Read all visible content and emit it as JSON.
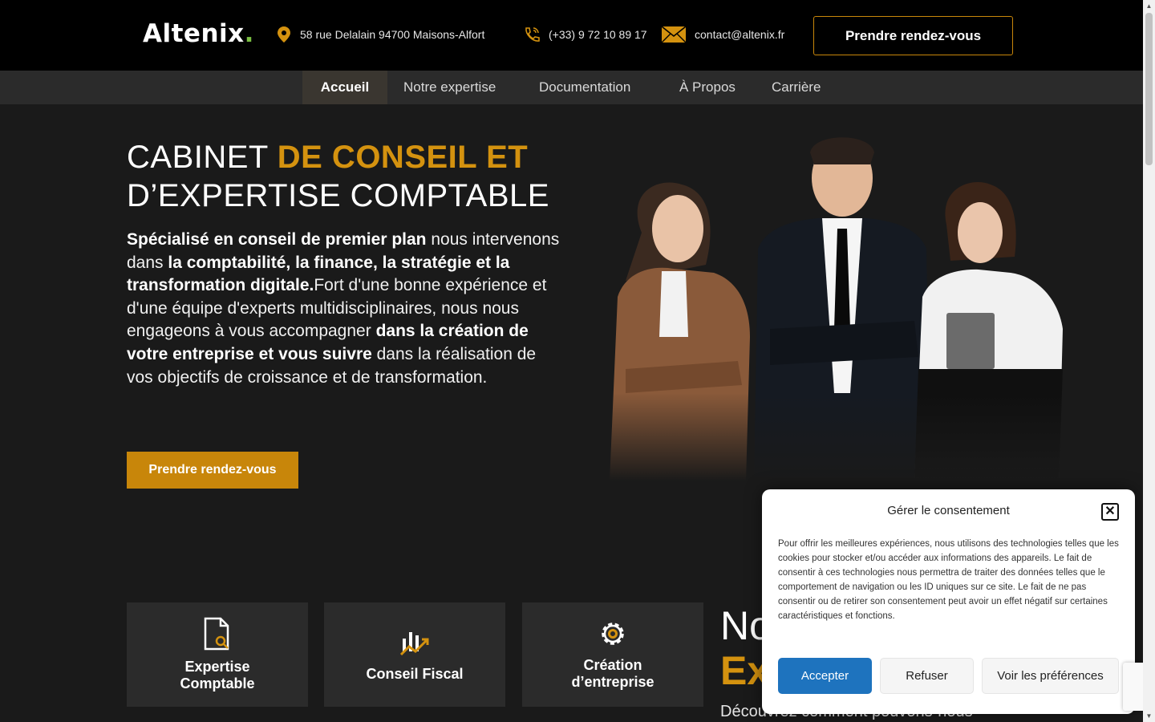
{
  "header": {
    "logo_text": "Altenix",
    "logo_dot": ".",
    "address": "58 rue Delalain 94700 Maisons-Alfort",
    "phone": "(+33) 9 72 10 89 17",
    "email": "contact@altenix.fr",
    "cta_label": "Prendre rendez-vous"
  },
  "nav": {
    "items": [
      {
        "label": "Accueil",
        "active": true
      },
      {
        "label": "Notre expertise"
      },
      {
        "label": "Documentation"
      },
      {
        "label": "À Propos"
      },
      {
        "label": "Carrière"
      }
    ]
  },
  "hero": {
    "title_part1": "CABINET ",
    "title_part2": "DE CONSEIL ET",
    "title_line2": "D’EXPERTISE COMPTABLE",
    "text_b1": "Spécialisé en conseil de premier plan",
    "text_1": " nous intervenons dans ",
    "text_b2": "la comptabilité, la finance, la stratégie et la transformation digitale.",
    "text_2": "Fort d'une bonne expérience et d'une équipe d'experts multidisciplinaires, nous nous engageons à vous accompagner ",
    "text_b3": "dans la création de votre entreprise et vous suivre",
    "text_3": " dans la réalisation de vos objectifs de croissance et de transformation.",
    "cta_label": "Prendre rendez-vous"
  },
  "cards": [
    {
      "line1": "Expertise",
      "line2": "Comptable",
      "icon": "document-search-icon"
    },
    {
      "line1": "Conseil Fiscal",
      "line2": "",
      "icon": "chart-growth-icon"
    },
    {
      "line1": "Création",
      "line2": "d’entreprise",
      "icon": "gear-icon"
    }
  ],
  "section": {
    "title_part1": "No",
    "title_part2": "Ex",
    "subtitle": "Découvrez comment pouvons-nous"
  },
  "consent": {
    "title": "Gérer le consentement",
    "text": "Pour offrir les meilleures expériences, nous utilisons des technologies telles que les cookies pour stocker et/ou accéder aux informations des appareils. Le fait de consentir à ces technologies nous permettra de traiter des données telles que le comportement de navigation ou les ID uniques sur ce site. Le fait de ne pas consentir ou de retirer son consentement peut avoir un effet négatif sur certaines caractéristiques et fonctions.",
    "accept": "Accepter",
    "refuse": "Refuser",
    "prefs": "Voir les préférences",
    "close": "✕"
  },
  "colors": {
    "gold": "#d4920f",
    "accept_blue": "#1e73be",
    "logo_green": "#7bc043"
  }
}
